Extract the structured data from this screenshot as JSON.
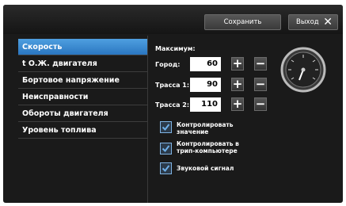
{
  "toolbar": {
    "save_label": "Сохранить",
    "exit_label": "Выход",
    "exit_icon": "close-icon"
  },
  "sidebar": {
    "items": [
      {
        "label": "Скорость",
        "active": true
      },
      {
        "label": "t О.Ж. двигателя",
        "active": false
      },
      {
        "label": "Бортовое напряжение",
        "active": false
      },
      {
        "label": "Неисправности",
        "active": false
      },
      {
        "label": "Обороты двигателя",
        "active": false
      },
      {
        "label": "Уровень топлива",
        "active": false
      }
    ]
  },
  "main": {
    "max_label": "Максимум:",
    "rows": [
      {
        "label": "Город:",
        "value": "60"
      },
      {
        "label": "Трасса 1:",
        "value": "90"
      },
      {
        "label": "Трасса 2:",
        "value": "110"
      }
    ],
    "checkboxes": [
      {
        "label_1": "Контролировать",
        "label_2": "значение",
        "checked": true
      },
      {
        "label_1": "Контролировать в",
        "label_2": "трип-компьютере",
        "checked": true
      },
      {
        "label_1": "Звуковой сигнал",
        "label_2": "",
        "checked": true
      }
    ],
    "gauge_icon": "speedometer-icon"
  },
  "colors": {
    "accent": "#3a8ad6",
    "background": "#1a1a1a",
    "button": "#474747"
  }
}
